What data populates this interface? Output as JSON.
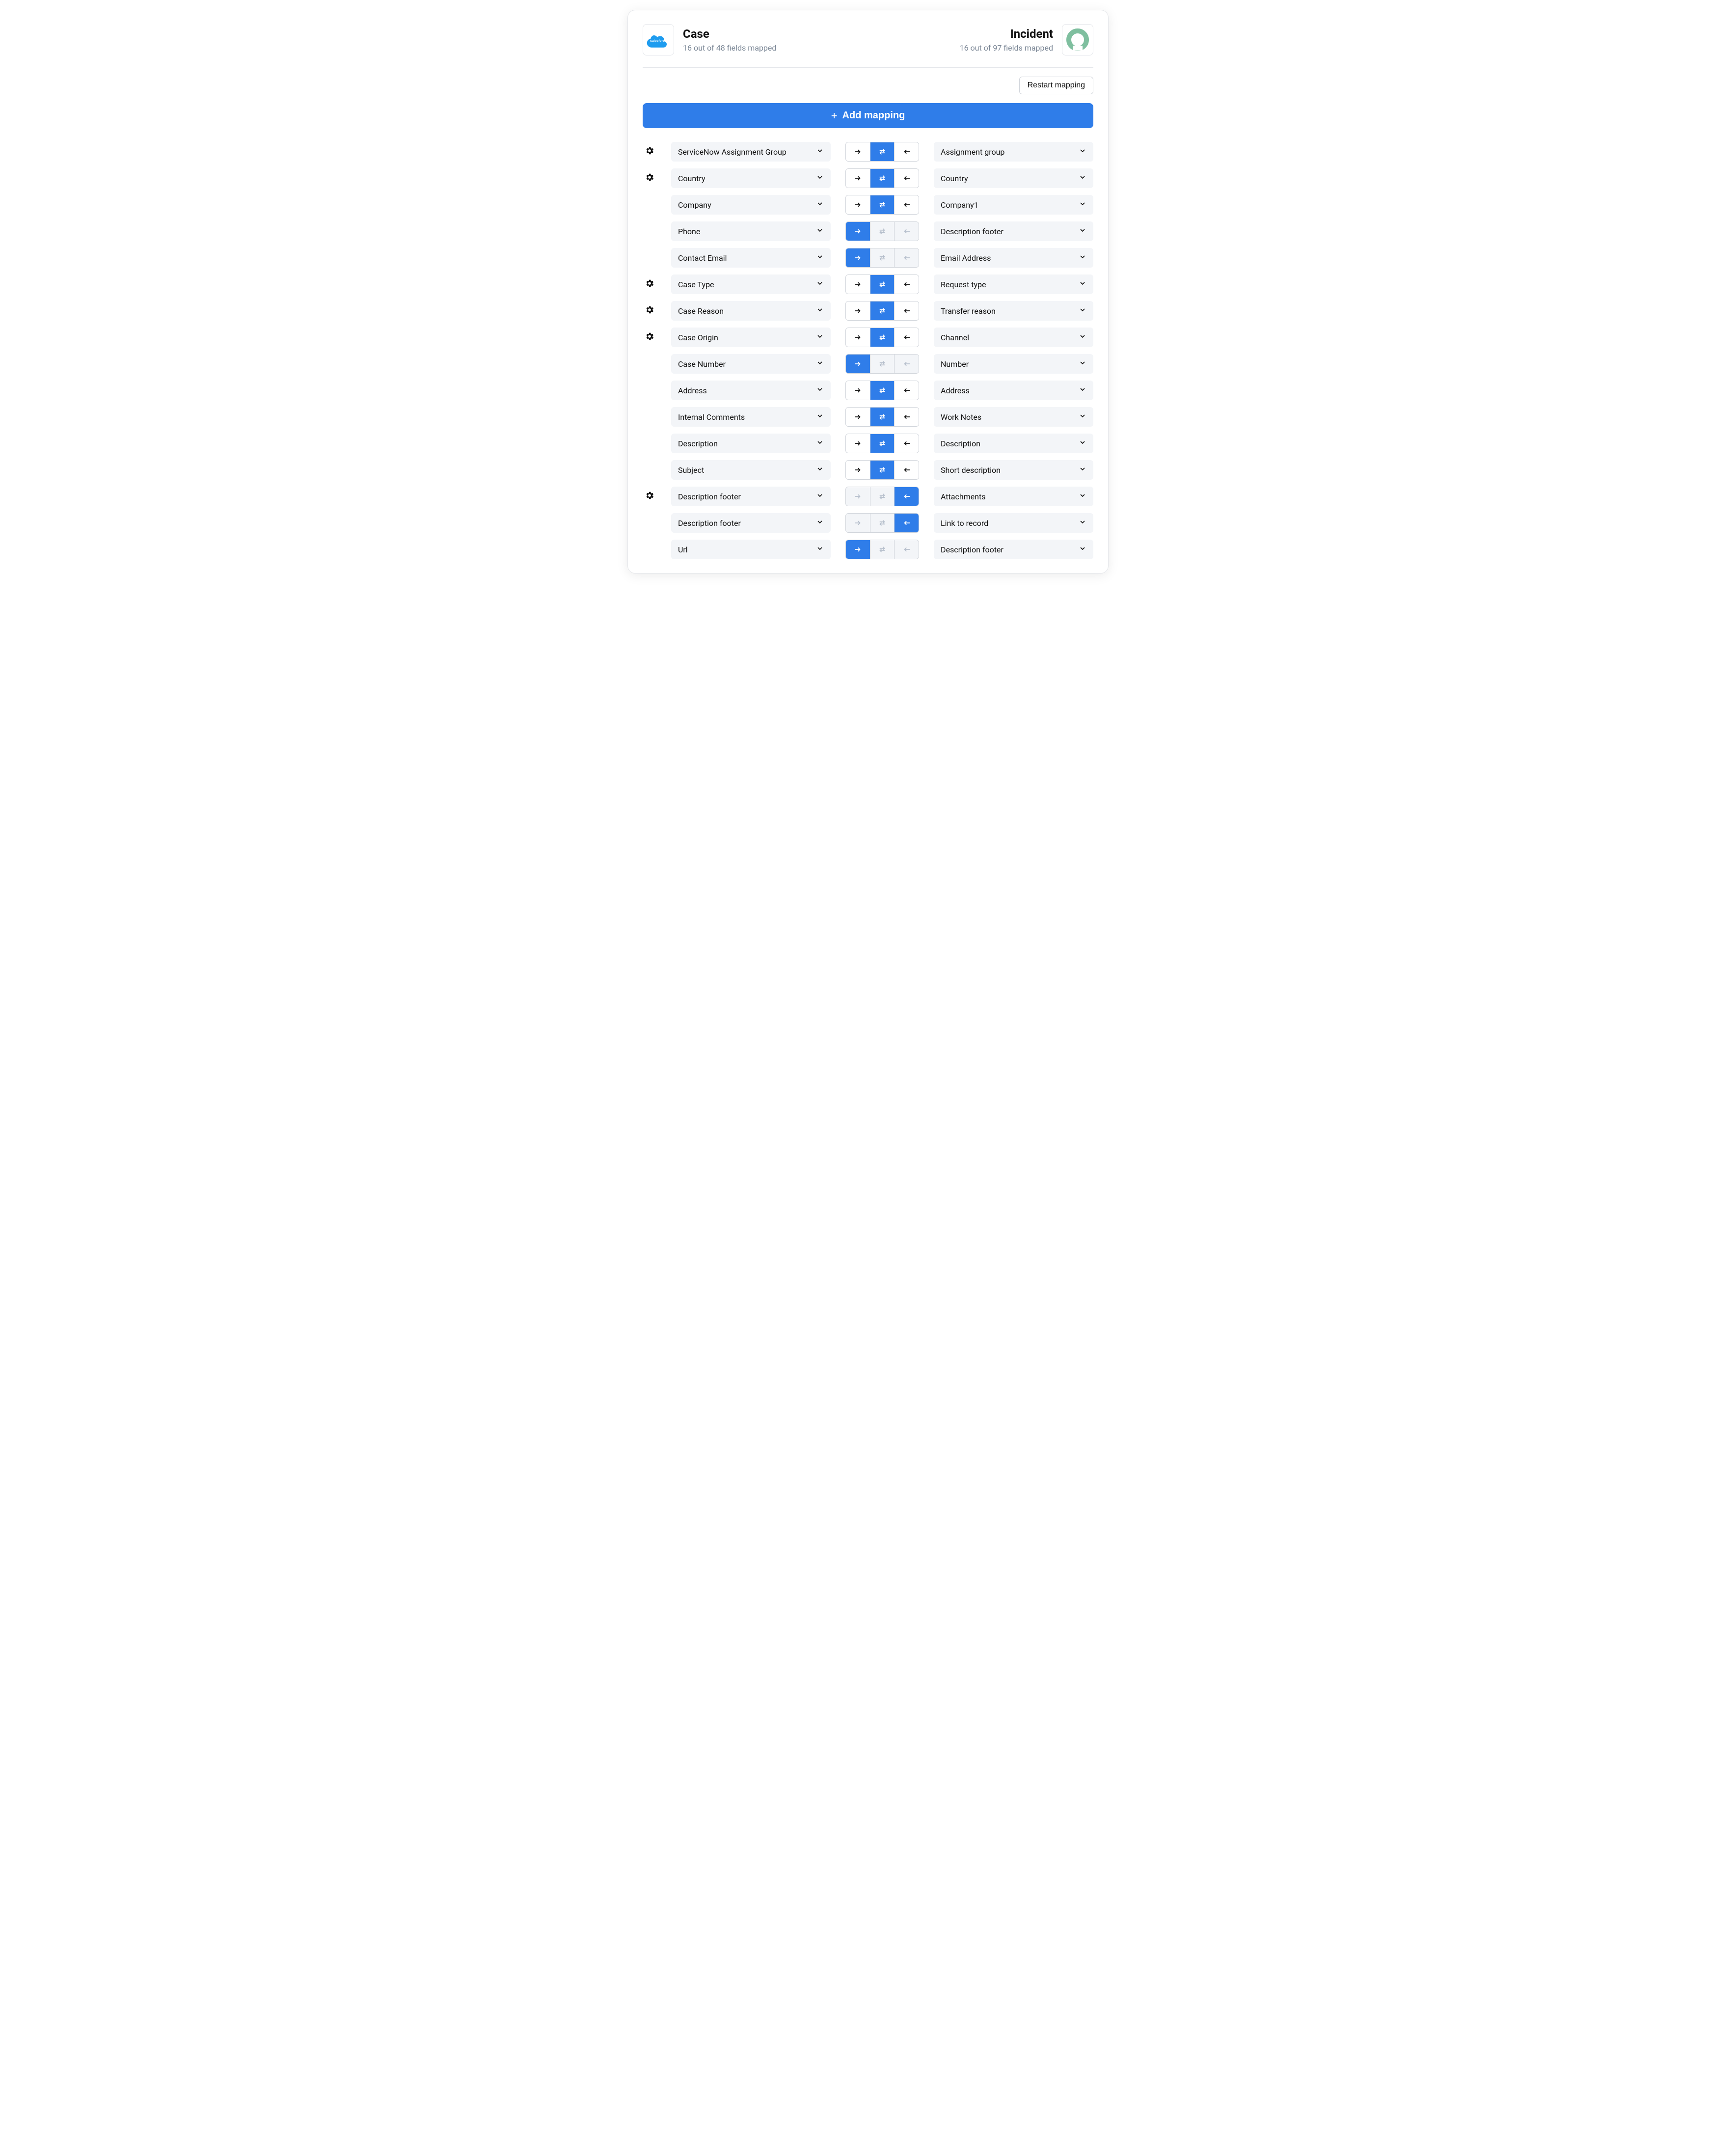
{
  "left": {
    "title": "Case",
    "subtitle": "16 out of 48 fields mapped"
  },
  "right": {
    "title": "Incident",
    "subtitle": "16 out of 97 fields mapped"
  },
  "buttons": {
    "restart": "Restart mapping",
    "add": "Add mapping"
  },
  "mappings": [
    {
      "gear": true,
      "left": "ServiceNow Assignment Group",
      "right": "Assignment group",
      "direction": "both"
    },
    {
      "gear": true,
      "left": "Country",
      "right": "Country",
      "direction": "both"
    },
    {
      "gear": false,
      "left": "Company",
      "right": "Company1",
      "direction": "both"
    },
    {
      "gear": false,
      "left": "Phone",
      "right": "Description footer",
      "direction": "right"
    },
    {
      "gear": false,
      "left": "Contact Email",
      "right": "Email Address",
      "direction": "right"
    },
    {
      "gear": true,
      "left": "Case Type",
      "right": "Request type",
      "direction": "both"
    },
    {
      "gear": true,
      "left": "Case Reason",
      "right": "Transfer reason",
      "direction": "both"
    },
    {
      "gear": true,
      "left": "Case Origin",
      "right": "Channel",
      "direction": "both"
    },
    {
      "gear": false,
      "left": "Case Number",
      "right": "Number",
      "direction": "right"
    },
    {
      "gear": false,
      "left": "Address",
      "right": "Address",
      "direction": "both"
    },
    {
      "gear": false,
      "left": "Internal Comments",
      "right": "Work Notes",
      "direction": "both"
    },
    {
      "gear": false,
      "left": "Description",
      "right": "Description",
      "direction": "both"
    },
    {
      "gear": false,
      "left": "Subject",
      "right": "Short description",
      "direction": "both"
    },
    {
      "gear": true,
      "left": "Description footer",
      "right": "Attachments",
      "direction": "left"
    },
    {
      "gear": false,
      "left": "Description footer",
      "right": "Link to record",
      "direction": "left"
    },
    {
      "gear": false,
      "left": "Url",
      "right": "Description footer",
      "direction": "right"
    }
  ]
}
